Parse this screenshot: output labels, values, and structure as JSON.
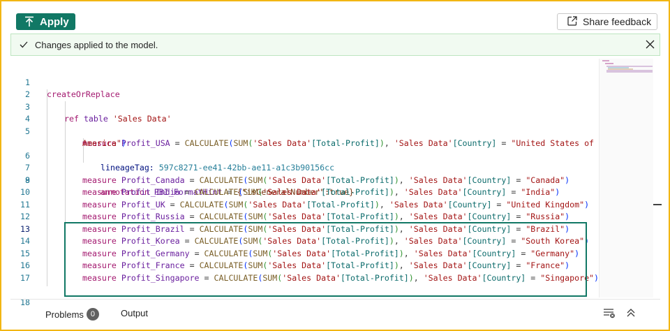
{
  "toolbar": {
    "apply_label": "Apply",
    "share_label": "Share feedback"
  },
  "notification": {
    "message": "Changes applied to the model."
  },
  "editor": {
    "line_numbers": [
      "1",
      "2",
      "3",
      "4",
      "5",
      "",
      "6",
      "7",
      "8",
      "9",
      "10",
      "11",
      "12",
      "13",
      "14",
      "15",
      "16",
      "17",
      "18"
    ],
    "lines": {
      "l1": "createOrReplace",
      "l3_kw": "ref",
      "l3_kw2": "table",
      "l3_str": "'Sales Data'",
      "l5_a": "measure",
      "l5_b": "Profit_USA",
      "l5_c": " = ",
      "l5_d": "CALCULATE",
      "l5_e": "SUM",
      "l5_f": "'Sales Data'",
      "l5_g": "[Total-Profit]",
      "l5_h": "'Sales Data'",
      "l5_i": "[Country]",
      "l5_j": "\"United States of",
      "l5_wrap": "America\"",
      "l6_a": "lineageTag:",
      "l6_b": "597c8271-ee41-42bb-ae11-a1c3b90156cc",
      "l8_a": "annotation",
      "l8_b": "PBI_FormatHint",
      "l8_c": "{\"isGeneralNumber\":true}"
    },
    "measures": [
      {
        "name": "Profit_Canada",
        "country": "\"Canada\""
      },
      {
        "name": "Profit_India",
        "country": "\"India\""
      },
      {
        "name": "Profit_UK",
        "country": "\"United Kingdom\""
      },
      {
        "name": "Profit_Russia",
        "country": "\"Russia\""
      },
      {
        "name": "Profit_Brazil",
        "country": "\"Brazil\""
      },
      {
        "name": "Profit_Korea",
        "country": "\"South Korea\""
      },
      {
        "name": "Profit_Germany",
        "country": "\"Germany\""
      },
      {
        "name": "Profit_France",
        "country": "\"France\""
      },
      {
        "name": "Profit_Singapore",
        "country": "\"Singapore\""
      }
    ]
  },
  "bottom_panel": {
    "problems_label": "Problems",
    "problems_count": "0",
    "output_label": "Output"
  },
  "colors": {
    "accent": "#117865",
    "frame": "#f2b613"
  }
}
